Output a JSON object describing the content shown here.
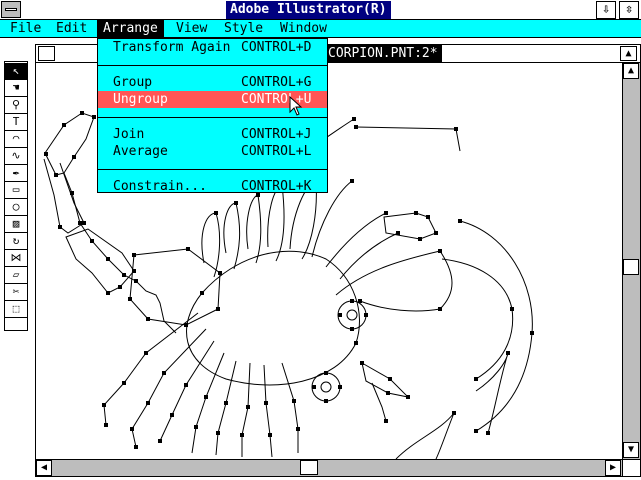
{
  "window": {
    "title": "Adobe Illustrator(R)",
    "minimize_glyph": "⇩",
    "restore_glyph": "⇳"
  },
  "menubar": [
    {
      "label": "File"
    },
    {
      "label": "Edit"
    },
    {
      "label": "Arrange"
    },
    {
      "label": "View"
    },
    {
      "label": "Style"
    },
    {
      "label": "Window"
    }
  ],
  "document": {
    "title": "CORPION.PNT:2*"
  },
  "arrange_menu": {
    "groups": [
      [
        {
          "label": "Transform Again",
          "shortcut": "CONTROL+D"
        }
      ],
      [
        {
          "label": "Group",
          "shortcut": "CONTROL+G"
        },
        {
          "label": "Ungroup",
          "shortcut": "CONTROL+U",
          "highlighted": true
        }
      ],
      [
        {
          "label": "Join",
          "shortcut": "CONTROL+J"
        },
        {
          "label": "Average",
          "shortcut": "CONTROL+L"
        }
      ],
      [
        {
          "label": "Constrain...",
          "shortcut": "CONTROL+K"
        }
      ]
    ]
  },
  "tools": [
    {
      "name": "selection-tool",
      "glyph": "↖",
      "selected": true
    },
    {
      "name": "hand-tool",
      "glyph": "☚"
    },
    {
      "name": "zoom-tool",
      "glyph": "⚲"
    },
    {
      "name": "type-tool",
      "glyph": "T"
    },
    {
      "name": "oval-tool",
      "glyph": "◠"
    },
    {
      "name": "freehand-tool",
      "glyph": "∿"
    },
    {
      "name": "pen-tool",
      "glyph": "✒"
    },
    {
      "name": "rectangle-tool",
      "glyph": "▭"
    },
    {
      "name": "ellipse-tool",
      "glyph": "◯"
    },
    {
      "name": "blend-tool",
      "glyph": "▨"
    },
    {
      "name": "rotate-tool",
      "glyph": "↻"
    },
    {
      "name": "reflect-tool",
      "glyph": "⋈"
    },
    {
      "name": "shear-tool",
      "glyph": "▱"
    },
    {
      "name": "scissors-tool",
      "glyph": "✂"
    },
    {
      "name": "page-tool",
      "glyph": "⬚"
    }
  ],
  "colors": {
    "menu_bg": "#00ffff",
    "highlight": "#ff5555",
    "titlebar_active": "#000080"
  }
}
